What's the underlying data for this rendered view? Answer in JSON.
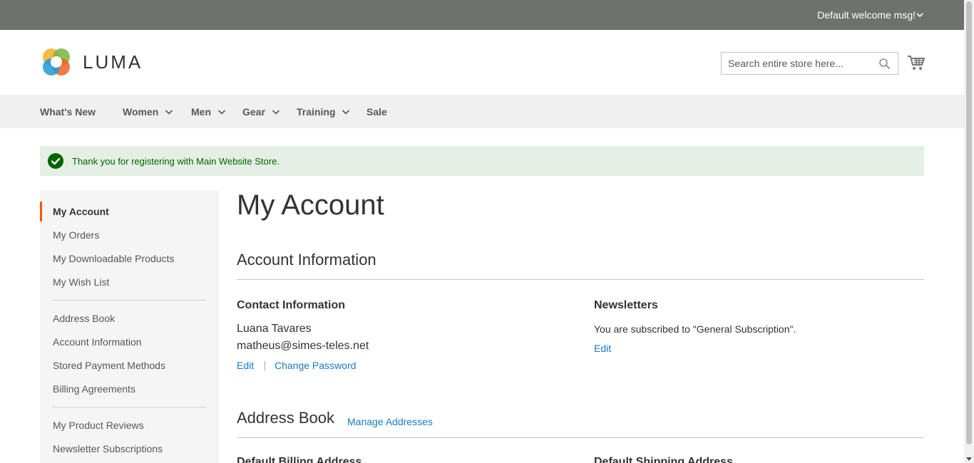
{
  "top_panel": {
    "welcome_text": "Default welcome msg!",
    "welcome_icon": "chevron-down-icon"
  },
  "header": {
    "logo_text": "LUMA",
    "search": {
      "placeholder": "Search entire store here...",
      "value": ""
    },
    "search_icon": "search-icon",
    "cart_icon": "cart-icon"
  },
  "nav": {
    "items": [
      {
        "label": "What's New",
        "has_dropdown": false
      },
      {
        "label": "Women",
        "has_dropdown": true
      },
      {
        "label": "Men",
        "has_dropdown": true
      },
      {
        "label": "Gear",
        "has_dropdown": true
      },
      {
        "label": "Training",
        "has_dropdown": true
      },
      {
        "label": "Sale",
        "has_dropdown": false
      }
    ]
  },
  "message": {
    "text": "Thank you for registering with Main Website Store.",
    "icon": "check-circle-icon",
    "color": "#006400"
  },
  "sidebar": {
    "groups": [
      [
        "My Account",
        "My Orders",
        "My Downloadable Products",
        "My Wish List"
      ],
      [
        "Address Book",
        "Account Information",
        "Stored Payment Methods",
        "Billing Agreements"
      ],
      [
        "My Product Reviews",
        "Newsletter Subscriptions"
      ]
    ],
    "active": "My Account",
    "active_color": "#ff5501"
  },
  "main": {
    "page_title": "My Account",
    "account_info": {
      "title": "Account Information",
      "contact": {
        "title": "Contact Information",
        "name": "Luana Tavares",
        "email": "matheus@simes-teles.net",
        "edit_label": "Edit",
        "change_password_label": "Change Password"
      },
      "newsletters": {
        "title": "Newsletters",
        "status": "You are subscribed to \"General Subscription\".",
        "edit_label": "Edit"
      }
    },
    "address_book": {
      "title": "Address Book",
      "manage_label": "Manage Addresses",
      "billing_title": "Default Billing Address",
      "shipping_title": "Default Shipping Address"
    }
  },
  "colors": {
    "top_panel_bg": "#6e716e",
    "nav_bg": "#f0f0f0",
    "link": "#1979c3",
    "message_bg": "#e5efe5"
  }
}
